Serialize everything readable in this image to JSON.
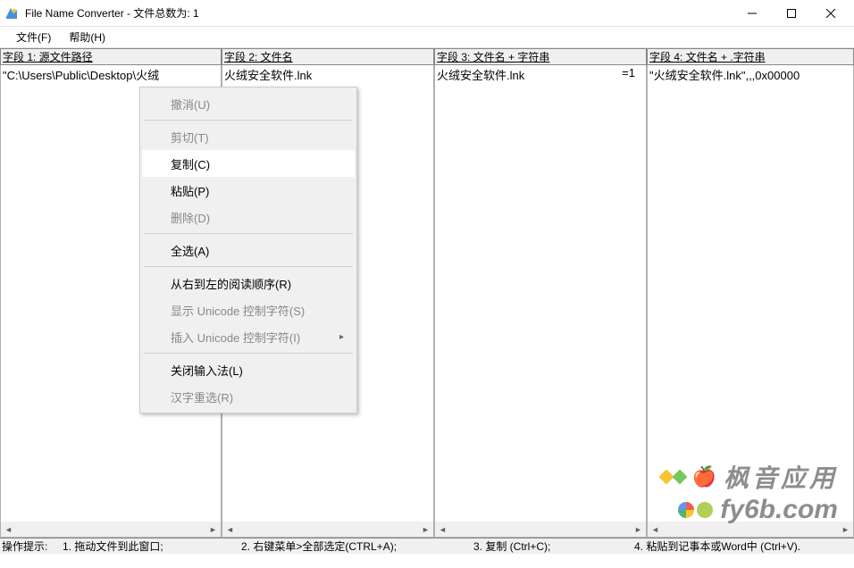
{
  "title": "File Name Converter - 文件总数为: 1",
  "menubar": {
    "file": "文件(F)",
    "help": "帮助(H)"
  },
  "columns": {
    "c1": {
      "header": "字段 1: 源文件路径",
      "line": "\"C:\\Users\\Public\\Desktop\\火绒"
    },
    "c2": {
      "header": "字段 2: 文件名",
      "line": "火绒安全软件.lnk"
    },
    "c3": {
      "header": "字段 3: 文件名  + 字符串",
      "line": "火绒安全软件.lnk",
      "eq": "=1"
    },
    "c4": {
      "header": "字段 4: 文件名 + .字符串",
      "line": "\"火绒安全软件.lnk\",,,0x00000"
    }
  },
  "context": {
    "undo": "撤消(U)",
    "cut": "剪切(T)",
    "copy": "复制(C)",
    "paste": "粘贴(P)",
    "delete": "删除(D)",
    "selectall": "全选(A)",
    "rtl": "从右到左的阅读顺序(R)",
    "showunicode": "显示 Unicode 控制字符(S)",
    "insertunicode": "插入 Unicode 控制字符(I)",
    "closeime": "关闭输入法(L)",
    "reconvert": "汉字重选(R)"
  },
  "status": {
    "label": "操作提示:",
    "s1": "1. 拖动文件到此窗口;",
    "s2": "2. 右键菜单>全部选定(CTRL+A);",
    "s3": "3. 复制 (Ctrl+C);",
    "s4": "4. 粘贴到记事本或Word中 (Ctrl+V)."
  },
  "watermark": {
    "line1": "枫音应用",
    "line2": "fy6b.com"
  }
}
